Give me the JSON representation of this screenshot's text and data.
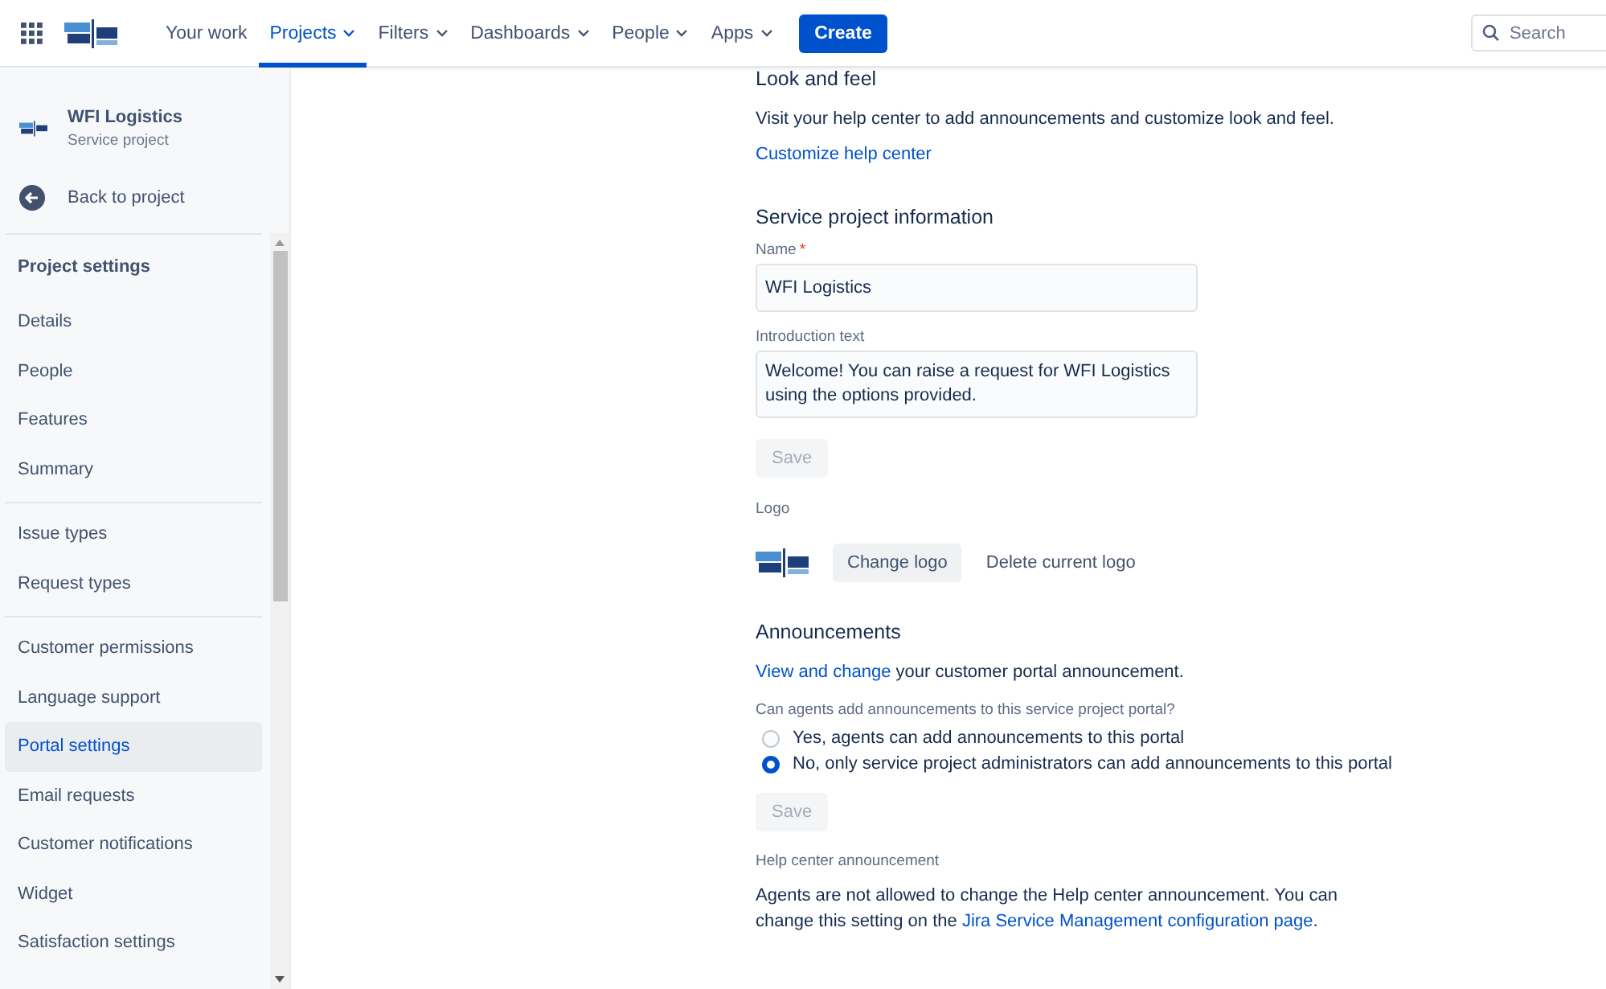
{
  "top_nav": {
    "items": [
      {
        "label": "Your work",
        "dropdown": false,
        "selected": false
      },
      {
        "label": "Projects",
        "dropdown": true,
        "selected": true
      },
      {
        "label": "Filters",
        "dropdown": true,
        "selected": false
      },
      {
        "label": "Dashboards",
        "dropdown": true,
        "selected": false
      },
      {
        "label": "People",
        "dropdown": true,
        "selected": false
      },
      {
        "label": "Apps",
        "dropdown": true,
        "selected": false
      }
    ],
    "create_button": "Create",
    "search": {
      "placeholder": "Search"
    }
  },
  "sidebar": {
    "project": {
      "name": "WFI Logistics",
      "type": "Service project"
    },
    "back_link": "Back to project",
    "sections": [
      {
        "heading": "Project settings",
        "items": [
          {
            "label": "Details",
            "selected": false
          },
          {
            "label": "People",
            "selected": false
          },
          {
            "label": "Features",
            "selected": false
          },
          {
            "label": "Summary",
            "selected": false
          }
        ]
      },
      {
        "items": [
          {
            "label": "Issue types",
            "selected": false
          },
          {
            "label": "Request types",
            "selected": false
          }
        ]
      },
      {
        "items": [
          {
            "label": "Customer permissions",
            "selected": false
          },
          {
            "label": "Language support",
            "selected": false
          },
          {
            "label": "Portal settings",
            "selected": true
          },
          {
            "label": "Email requests",
            "selected": false
          },
          {
            "label": "Customer notifications",
            "selected": false
          },
          {
            "label": "Widget",
            "selected": false
          },
          {
            "label": "Satisfaction settings",
            "selected": false
          }
        ]
      }
    ]
  },
  "look_and_feel": {
    "title": "Look and feel",
    "description": "Visit your help center to add announcements and customize look and feel.",
    "link": "Customize help center"
  },
  "service_project_information": {
    "title": "Service project information",
    "name_label": "Name",
    "required_mark": "*",
    "name_value": "WFI Logistics",
    "intro_label": "Introduction text",
    "intro_value": "Welcome! You can raise a request for WFI Logistics using the options provided.",
    "save_button": {
      "label": "Save",
      "disabled": true
    },
    "logo_label": "Logo",
    "change_logo_button": "Change logo",
    "delete_logo_button": "Delete current logo"
  },
  "announcements": {
    "title": "Announcements",
    "link": "View and change",
    "text": " your customer portal announcement.",
    "question": "Can agents add announcements to this service project portal?",
    "options": [
      {
        "label": "Yes, agents can add announcements to this portal",
        "selected": false
      },
      {
        "label": "No, only service project administrators can add announcements to this portal",
        "selected": true
      }
    ],
    "save_button": {
      "label": "Save",
      "disabled": true
    },
    "help_center_label": "Help center announcement",
    "help_text": "Agents are not allowed to change the Help center announcement. You can change this setting on the ",
    "help_link": "Jira Service Management configuration page",
    "help_after": "."
  }
}
